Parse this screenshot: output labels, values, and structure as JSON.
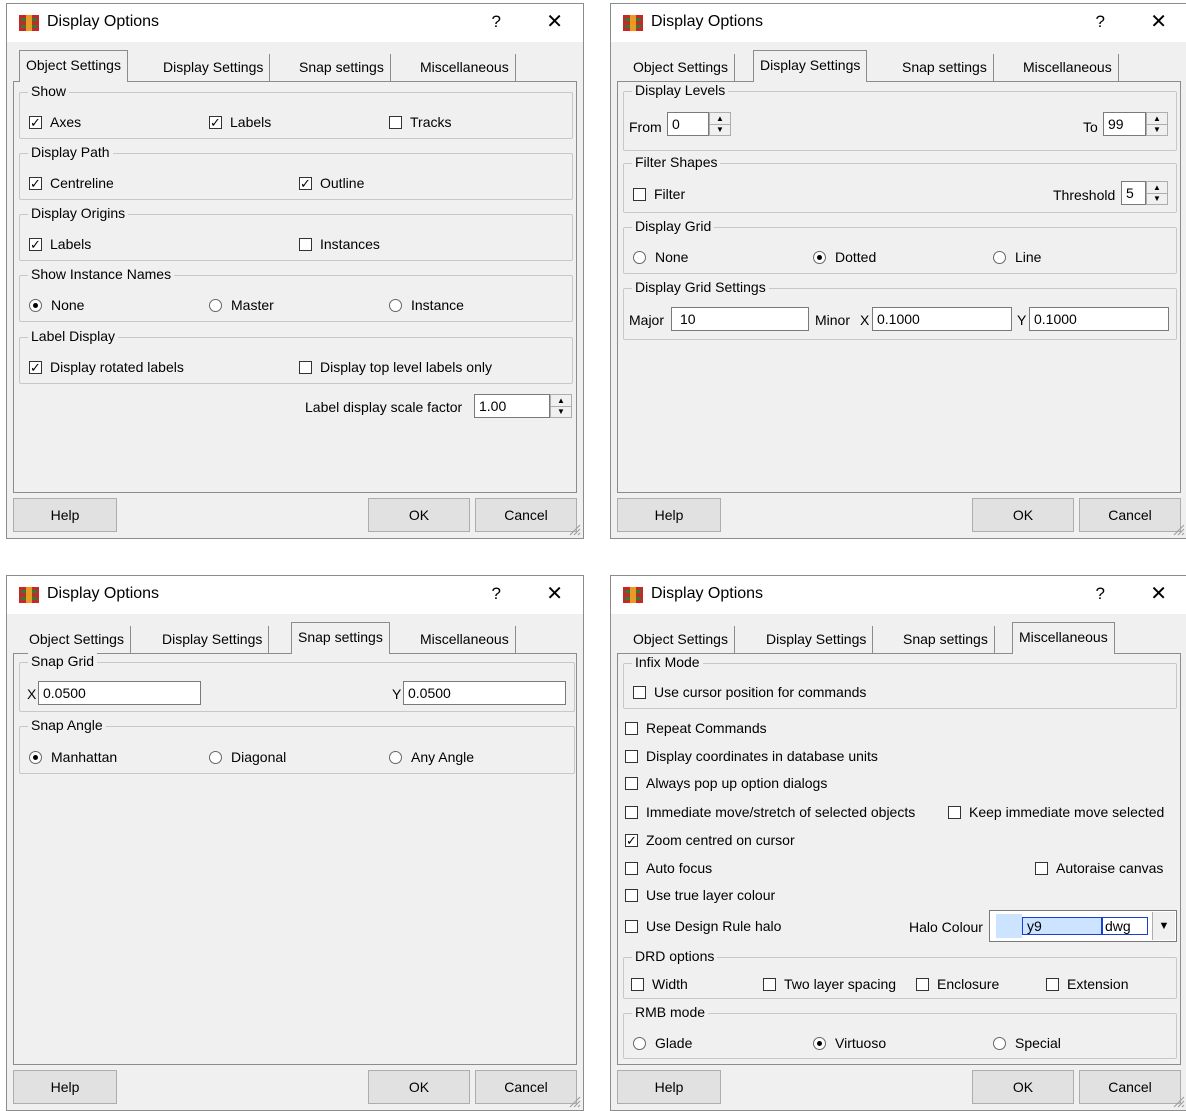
{
  "dialog_title": "Display Options",
  "help_glyph": "?",
  "close_glyph": "✕",
  "tabs": [
    "Object Settings",
    "Display Settings",
    "Snap settings",
    "Miscellaneous"
  ],
  "buttons": {
    "help": "Help",
    "ok": "OK",
    "cancel": "Cancel"
  },
  "object_settings": {
    "show": {
      "label": "Show",
      "axes": "Axes",
      "labels": "Labels",
      "tracks": "Tracks",
      "axes_checked": true,
      "labels_checked": true,
      "tracks_checked": false
    },
    "display_path": {
      "label": "Display Path",
      "centreline": "Centreline",
      "outline": "Outline",
      "centreline_checked": true,
      "outline_checked": true
    },
    "display_origins": {
      "label": "Display Origins",
      "labels": "Labels",
      "instances": "Instances",
      "labels_checked": true,
      "instances_checked": false
    },
    "instance_names": {
      "label": "Show Instance Names",
      "none": "None",
      "master": "Master",
      "instance": "Instance",
      "selected": "none"
    },
    "label_display": {
      "label": "Label Display",
      "rotated": "Display rotated labels",
      "top_level": "Display top level labels only",
      "rotated_checked": true,
      "top_level_checked": false
    },
    "scale_factor": {
      "label": "Label display scale factor",
      "value": "1.00"
    }
  },
  "display_settings": {
    "levels": {
      "label": "Display Levels",
      "from_label": "From",
      "from_value": "0",
      "to_label": "To",
      "to_value": "99"
    },
    "filter": {
      "label": "Filter Shapes",
      "filter": "Filter",
      "filter_checked": false,
      "threshold_label": "Threshold",
      "threshold_value": "5"
    },
    "grid": {
      "label": "Display Grid",
      "none": "None",
      "dotted": "Dotted",
      "line": "Line",
      "selected": "dotted"
    },
    "grid_settings": {
      "label": "Display Grid Settings",
      "major_label": "Major",
      "major_value": "10",
      "minor_label": "Minor",
      "x_label": "X",
      "x_value": "0.1000",
      "y_label": "Y",
      "y_value": "0.1000"
    }
  },
  "snap_settings": {
    "snap_grid": {
      "label": "Snap Grid",
      "x_label": "X",
      "x_value": "0.0500",
      "y_label": "Y",
      "y_value": "0.0500"
    },
    "snap_angle": {
      "label": "Snap Angle",
      "manhattan": "Manhattan",
      "diagonal": "Diagonal",
      "any_angle": "Any Angle",
      "selected": "manhattan"
    }
  },
  "miscellaneous": {
    "infix": {
      "label": "Infix Mode",
      "cursor": "Use cursor position for commands",
      "checked": false
    },
    "repeat": "Repeat Commands",
    "db_units": "Display coordinates in database units",
    "popup": "Always pop up option dialogs",
    "immediate": "Immediate move/stretch of selected objects",
    "keep_selected": "Keep immediate move selected",
    "zoom": "Zoom centred on cursor",
    "zoom_checked": true,
    "autofocus": "Auto focus",
    "autoraise": "Autoraise canvas",
    "true_colour": "Use true layer colour",
    "halo": "Use Design Rule halo",
    "halo_colour_label": "Halo Colour",
    "halo_layer": "y9",
    "halo_purpose": "dwg",
    "drd": {
      "label": "DRD options",
      "width": "Width",
      "two_layer": "Two layer spacing",
      "enclosure": "Enclosure",
      "extension": "Extension"
    },
    "rmb": {
      "label": "RMB mode",
      "glade": "Glade",
      "virtuoso": "Virtuoso",
      "special": "Special",
      "selected": "virtuoso"
    }
  },
  "colors": {
    "dialog_bg": "#f0f0f0",
    "button_bg": "#e1e1e1",
    "halo_highlight": "#cce4ff",
    "halo_border": "#1a3fd6"
  }
}
